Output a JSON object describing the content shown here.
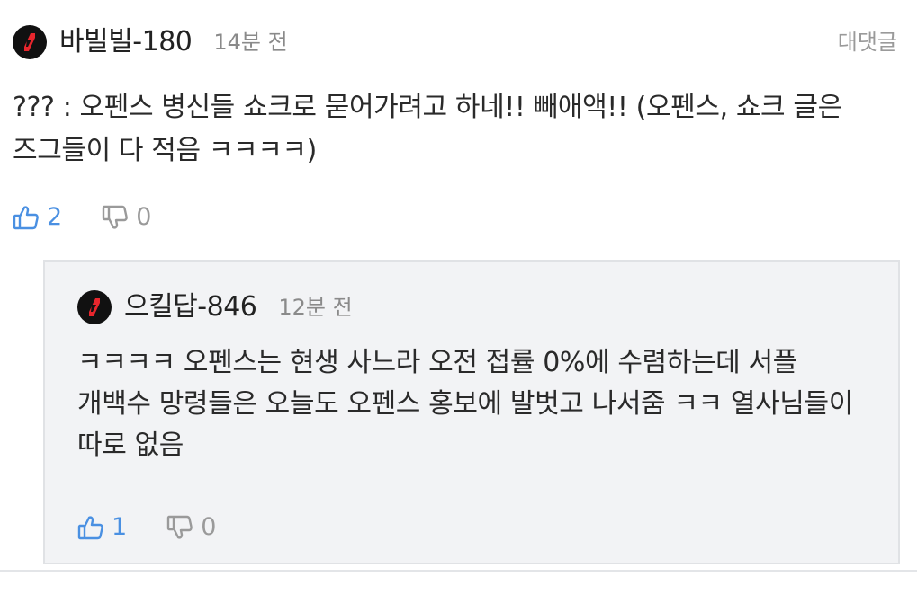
{
  "comment": {
    "username": "바빌빌-180",
    "timestamp": "14분 전",
    "reply_label": "대댓글",
    "text": "??? : 오펜스 병신들 쇼크로 묻어가려고 하네!! 빼애액!! (오펜스, 쇼크 글은 즈그들이 다 적음 ㅋㅋㅋㅋ)",
    "likes": "2",
    "dislikes": "0"
  },
  "reply": {
    "username": "으킬답-846",
    "timestamp": "12분 전",
    "text": "ㅋㅋㅋㅋ 오펜스는 현생 사느라 오전 접률 0%에 수렴하는데 서플 개백수 망령들은 오늘도 오펜스 홍보에 발벗고 나서줌 ㅋㅋ 열사님들이 따로 없음",
    "likes": "1",
    "dislikes": "0"
  },
  "icons": {
    "avatar": "red-slash-badge-icon",
    "like": "thumbs-up-icon",
    "dislike": "thumbs-down-icon"
  },
  "colors": {
    "like_blue": "#4a90e2",
    "avatar_red": "#e8262d",
    "muted_gray": "#9a9a9a",
    "reply_bg": "#f2f3f5"
  }
}
